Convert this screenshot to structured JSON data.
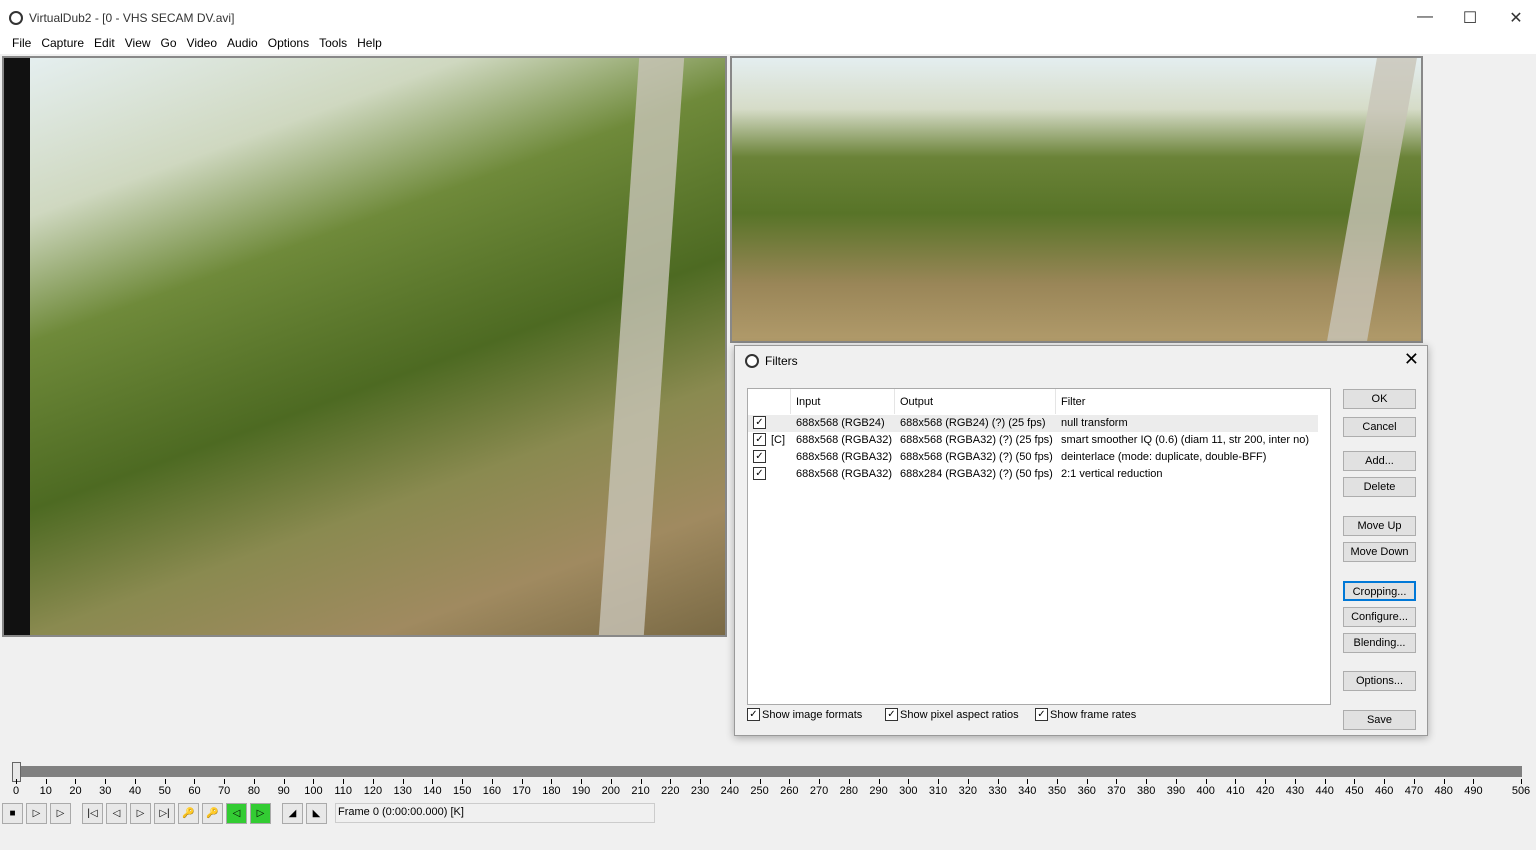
{
  "window": {
    "title": "VirtualDub2 - [0 - VHS SECAM DV.avi]",
    "minimize": "—",
    "maximize": "☐",
    "close": "✕"
  },
  "menu": [
    "File",
    "Capture",
    "Edit",
    "View",
    "Go",
    "Video",
    "Audio",
    "Options",
    "Tools",
    "Help"
  ],
  "dialog": {
    "title": "Filters",
    "close": "✕",
    "columns": [
      "Input",
      "Output",
      "Filter"
    ],
    "rows": [
      {
        "checked": true,
        "flag": "",
        "input": "688x568 (RGB24)",
        "output": "688x568 (RGB24) (?) (25 fps)",
        "filter": "null transform"
      },
      {
        "checked": true,
        "flag": "[C]",
        "input": "688x568 (RGBA32)",
        "output": "688x568 (RGBA32) (?) (25 fps)",
        "filter": "smart smoother IQ (0.6) (diam 11, str 200, inter no)"
      },
      {
        "checked": true,
        "flag": "",
        "input": "688x568 (RGBA32)",
        "output": "688x568 (RGBA32) (?) (50 fps)",
        "filter": "deinterlace (mode: duplicate, double-BFF)"
      },
      {
        "checked": true,
        "flag": "",
        "input": "688x568 (RGBA32)",
        "output": "688x284 (RGBA32) (?) (50 fps)",
        "filter": "2:1 vertical reduction"
      }
    ],
    "buttons": {
      "ok": "OK",
      "cancel": "Cancel",
      "add": "Add...",
      "delete": "Delete",
      "move_up": "Move Up",
      "move_down": "Move Down",
      "cropping": "Cropping...",
      "configure": "Configure...",
      "blending": "Blending...",
      "options": "Options...",
      "save": "Save"
    },
    "checkboxes": [
      {
        "label": "Show image formats",
        "checked": true
      },
      {
        "label": "Show pixel aspect ratios",
        "checked": true
      },
      {
        "label": "Show frame rates",
        "checked": true
      }
    ]
  },
  "timeline": {
    "min": 0,
    "max": 506,
    "position": 0,
    "labels": [
      "0",
      "10",
      "20",
      "30",
      "40",
      "50",
      "60",
      "70",
      "80",
      "90",
      "100",
      "110",
      "120",
      "130",
      "140",
      "150",
      "160",
      "170",
      "180",
      "190",
      "200",
      "210",
      "220",
      "230",
      "240",
      "250",
      "260",
      "270",
      "280",
      "290",
      "300",
      "310",
      "320",
      "330",
      "340",
      "350",
      "360",
      "370",
      "380",
      "390",
      "400",
      "410",
      "420",
      "430",
      "440",
      "450",
      "460",
      "470",
      "480",
      "490",
      "506"
    ]
  },
  "status": {
    "frame": "Frame 0 (0:00:00.000) [K]"
  }
}
